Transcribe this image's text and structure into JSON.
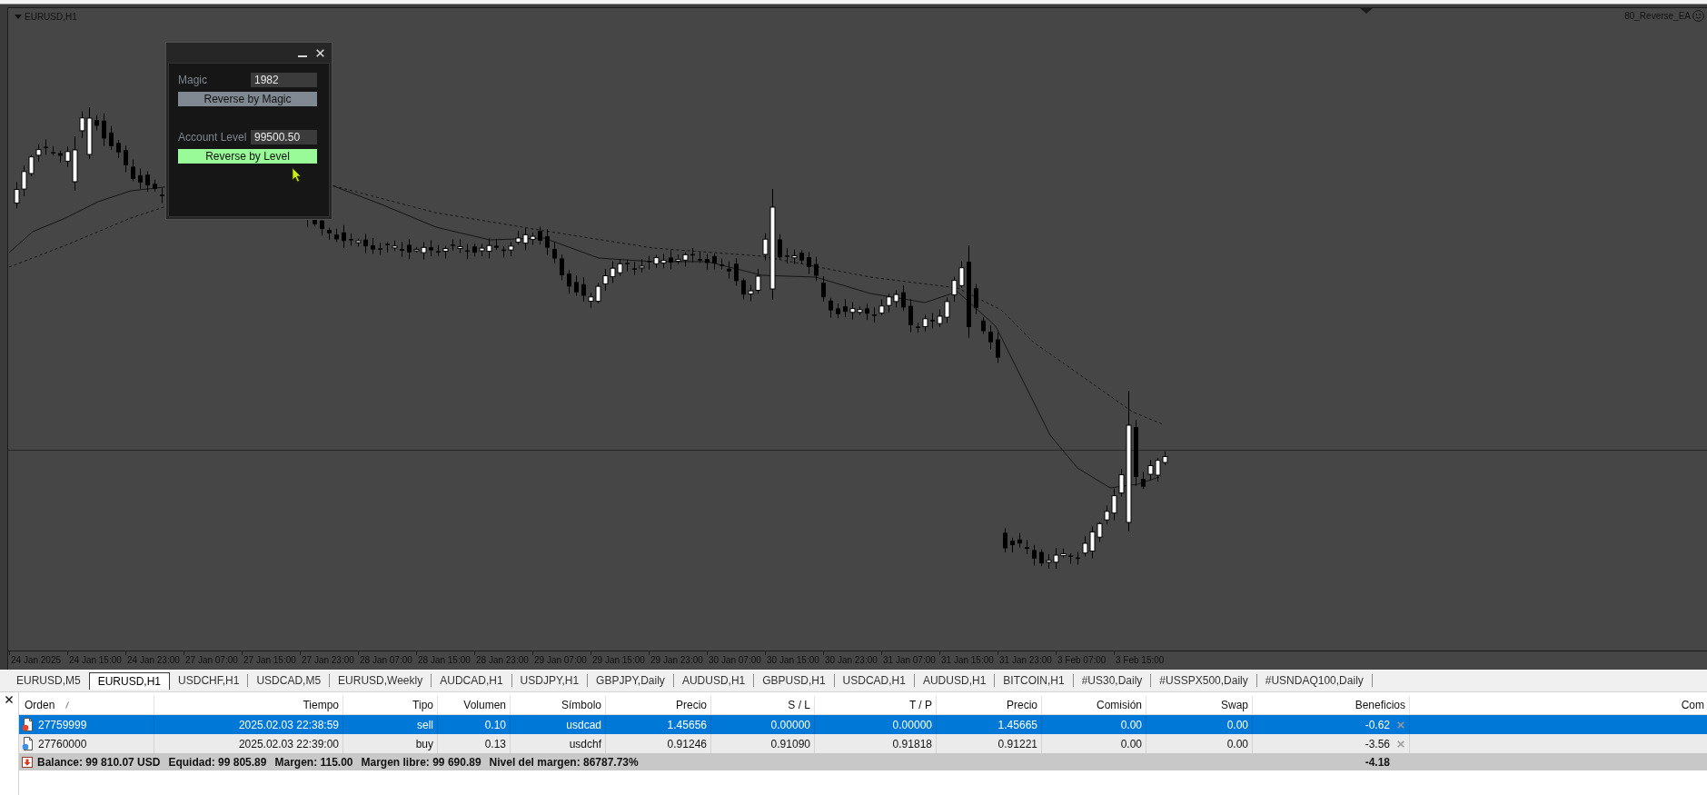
{
  "chart": {
    "title": "EURUSD,H1",
    "expert": "80_Reverse_EA",
    "time_axis_labels": [
      "24 Jan 2025",
      "24 Jan 15:00",
      "24 Jan 23:00",
      "27 Jan 07:00",
      "27 Jan 15:00",
      "27 Jan 23:00",
      "28 Jan 07:00",
      "28 Jan 15:00",
      "28 Jan 23:00",
      "29 Jan 07:00",
      "29 Jan 15:00",
      "29 Jan 23:00",
      "30 Jan 07:00",
      "30 Jan 15:00",
      "30 Jan 23:00",
      "31 Jan 07:00",
      "31 Jan 15:00",
      "31 Jan 23:00",
      "3 Feb 07:00",
      "3 Feb 15:00"
    ]
  },
  "panel": {
    "sections": [
      {
        "label": "Magic",
        "value": "1982",
        "button": "Reverse by Magic",
        "color": "#808891"
      },
      {
        "label": "Account Level",
        "value": "99500.50",
        "button": "Reverse by Level",
        "color": "#98fb98"
      }
    ]
  },
  "chart_tabs": [
    {
      "label": "EURUSD,M5",
      "selected": false
    },
    {
      "label": "EURUSD,H1",
      "selected": true
    },
    {
      "label": "USDCHF,H1",
      "selected": false
    },
    {
      "label": "USDCAD,M5",
      "selected": false
    },
    {
      "label": "EURUSD,Weekly",
      "selected": false
    },
    {
      "label": "AUDCAD,H1",
      "selected": false
    },
    {
      "label": "USDJPY,H1",
      "selected": false
    },
    {
      "label": "GBPJPY,Daily",
      "selected": false
    },
    {
      "label": "AUDUSD,H1",
      "selected": false
    },
    {
      "label": "GBPUSD,H1",
      "selected": false
    },
    {
      "label": "USDCAD,H1",
      "selected": false
    },
    {
      "label": "AUDUSD,H1",
      "selected": false
    },
    {
      "label": "BITCOIN,H1",
      "selected": false
    },
    {
      "label": "#US30,Daily",
      "selected": false
    },
    {
      "label": "#USSPX500,Daily",
      "selected": false
    },
    {
      "label": "#USNDAQ100,Daily",
      "selected": false
    }
  ],
  "trade_table": {
    "columns": [
      "Orden",
      "Tiempo",
      "Tipo",
      "Volumen",
      "Símbolo",
      "Precio",
      "S / L",
      "T / P",
      "Precio",
      "Comisión",
      "Swap",
      "Beneficios",
      "Com"
    ],
    "rows": [
      {
        "selected": true,
        "color": "#e8422c",
        "cells": [
          "27759999",
          "2025.02.03 22:38:59",
          "sell",
          "0.10",
          "usdcad",
          "1.45656",
          "0.00000",
          "0.00000",
          "1.45665",
          "0.00",
          "0.00",
          "-0.62"
        ]
      },
      {
        "selected": false,
        "color": "#3c8ee6",
        "cells": [
          "27760000",
          "2025.02.03 22:39:00",
          "buy",
          "0.13",
          "usdchf",
          "0.91246",
          "0.91090",
          "0.91818",
          "0.91221",
          "0.00",
          "0.00",
          "-3.56"
        ]
      }
    ],
    "summary": {
      "items": [
        "Balance: 99 810.07 USD",
        "Equidad: 99 805.89",
        "Margen: 115.00",
        "Margen libre: 99 690.89",
        "Nivel del margen: 86787.73%"
      ],
      "profit": "-4.18"
    }
  }
}
